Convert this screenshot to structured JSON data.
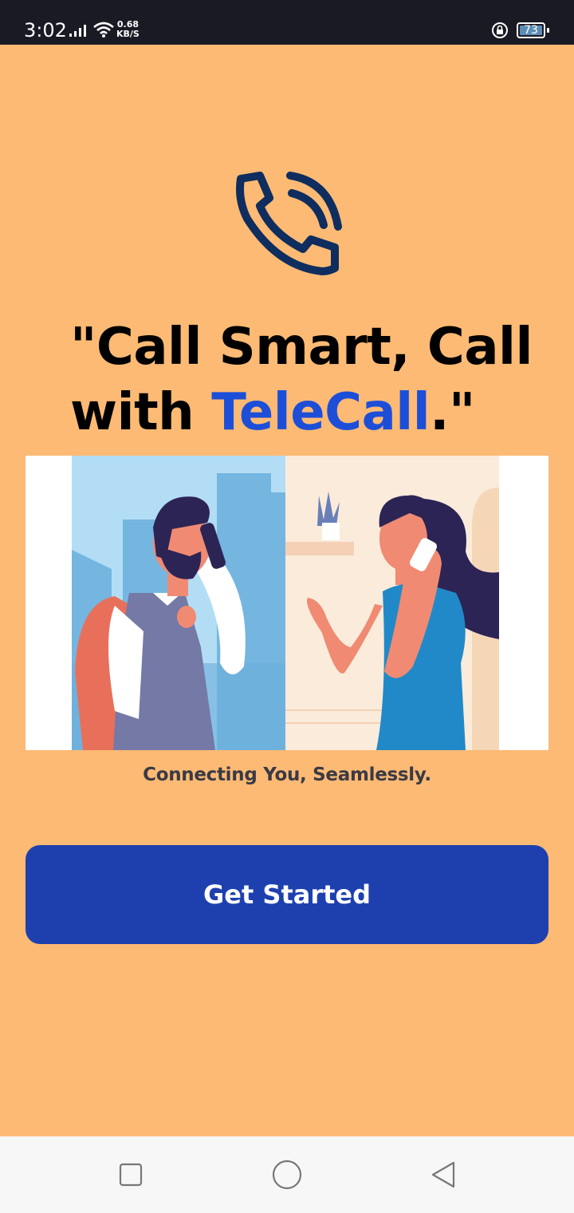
{
  "status_bar": {
    "time": "3:02",
    "net_speed_value": "0.68",
    "net_speed_unit": "KB/S",
    "battery": "73",
    "icons": [
      "signal-icon",
      "wifi-icon",
      "rotation-lock-icon",
      "battery-icon"
    ]
  },
  "hero": {
    "logo_icon": "phone-call-icon",
    "headline_line1": "\"Call Smart, Call",
    "headline_with": "with",
    "headline_brand": "TeleCall",
    "headline_end": ".\"",
    "illustration": "two-people-phone-call-illustration",
    "tagline": "Connecting You, Seamlessly."
  },
  "actions": {
    "get_started_label": "Get Started"
  },
  "nav_bar": {
    "icons": [
      "recents-square-icon",
      "home-circle-icon",
      "back-triangle-icon"
    ]
  },
  "colors": {
    "background": "#FDBA74",
    "brand_text": "#1D4ED8",
    "button": "#1E40AF",
    "logo": "#0F2D5E"
  }
}
